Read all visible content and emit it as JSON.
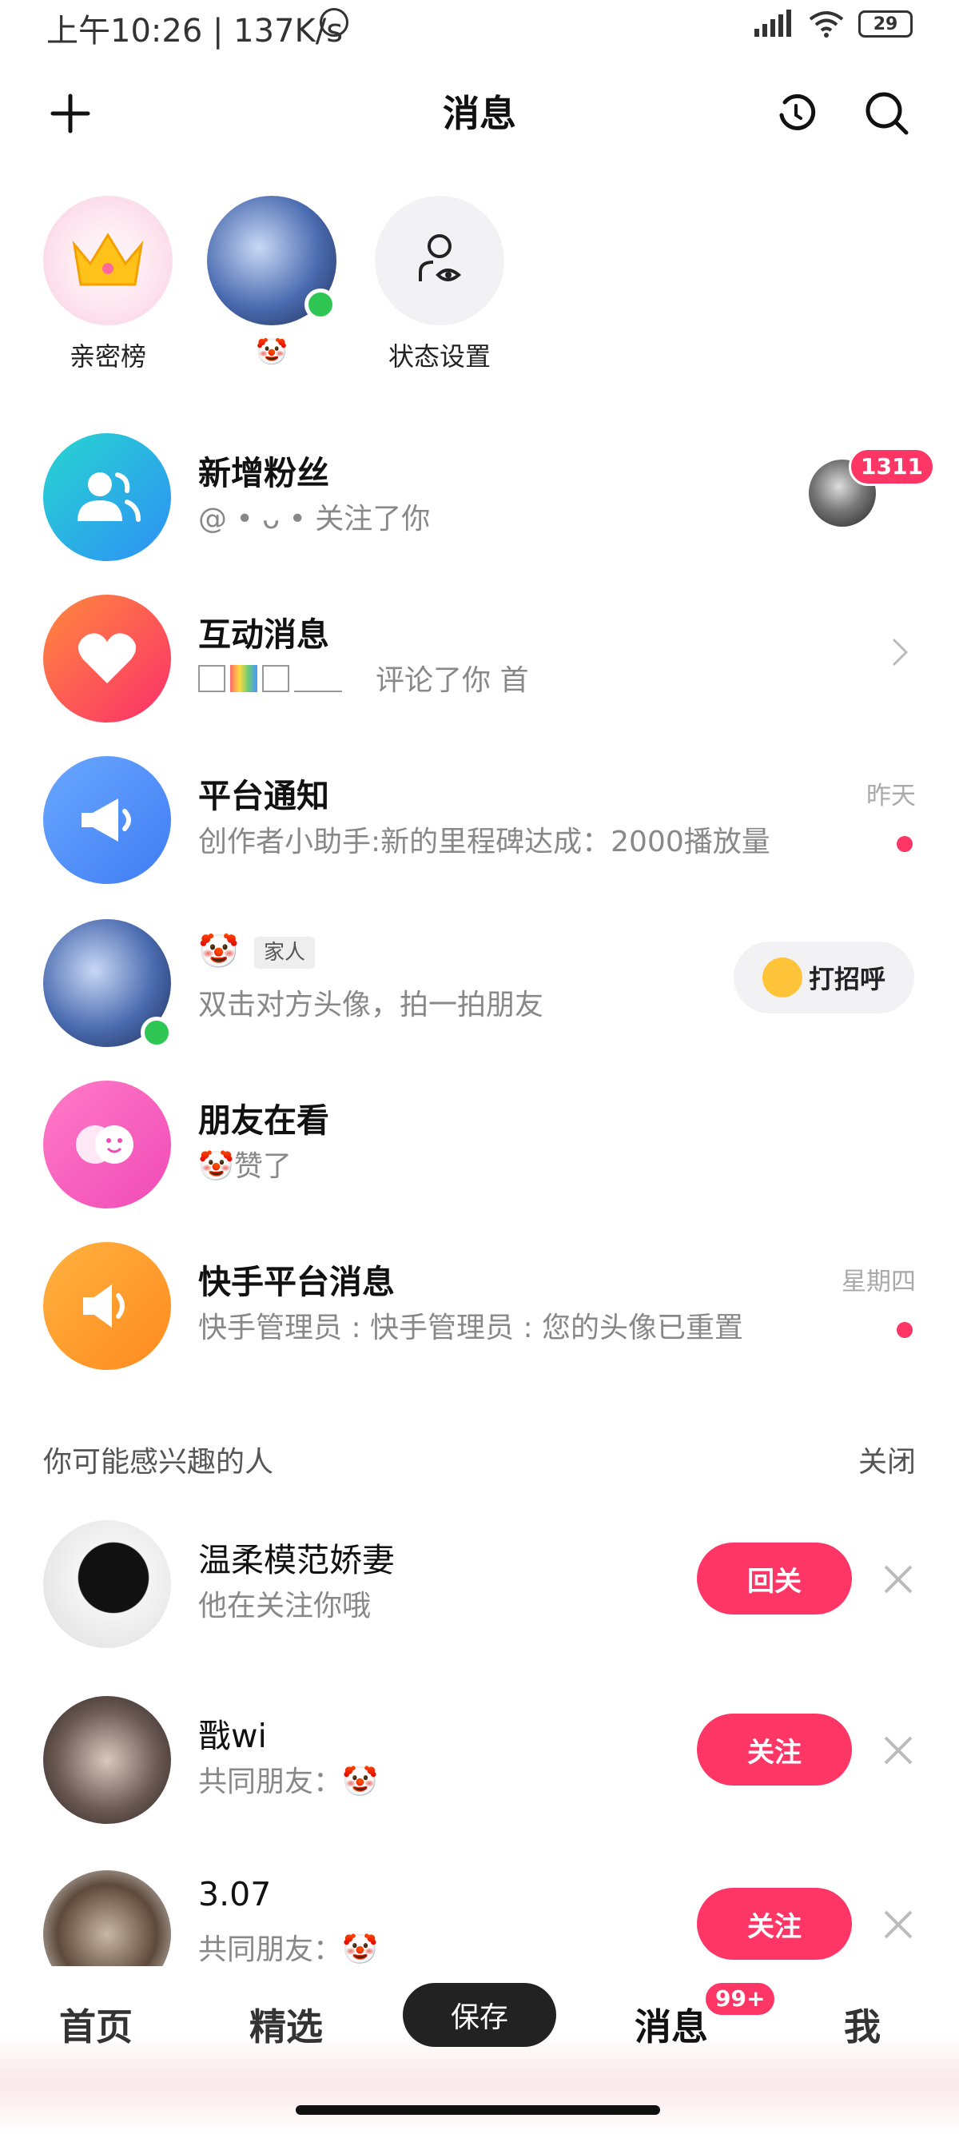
{
  "status": {
    "time": "上午10:26 | 137K/s",
    "battery": "29"
  },
  "header": {
    "title": "消息"
  },
  "shortcuts": [
    {
      "label": "亲密榜"
    },
    {
      "label": "🤡"
    },
    {
      "label": "状态设置"
    }
  ],
  "messages": [
    {
      "name": "新增粉丝",
      "sub": "@ • ᴗ • 关注了你",
      "badge": "1311"
    },
    {
      "name": "互动消息",
      "sub": "评论了你 首"
    },
    {
      "name": "平台通知",
      "sub": "创作者小助手:新的里程碑达成：2000播放量",
      "time": "昨天"
    },
    {
      "name": "🤡",
      "tag": "家人",
      "sub": "双击对方头像，拍一拍朋友",
      "action": "打招呼"
    },
    {
      "name": "朋友在看",
      "sub": "🤡赞了"
    },
    {
      "name": "快手平台消息",
      "sub": "快手管理员 : 快手管理员 : 您的头像已重置",
      "time": "星期四"
    }
  ],
  "suggest": {
    "title": "你可能感兴趣的人",
    "close": "关闭",
    "items": [
      {
        "name": "温柔模范娇妻",
        "sub": "他在关注你哦",
        "button": "回关"
      },
      {
        "name": "戬wi",
        "sub": "共同朋友：🤡",
        "button": "关注"
      },
      {
        "name": "3.07",
        "sub": "共同朋友：🤡",
        "button": "关注"
      }
    ]
  },
  "nav": {
    "home": "首页",
    "featured": "精选",
    "messages": "消息",
    "messages_badge": "99+",
    "me": "我"
  },
  "toast": "保存",
  "colors": {
    "accent": "#fe3666",
    "online": "#2fc653"
  }
}
